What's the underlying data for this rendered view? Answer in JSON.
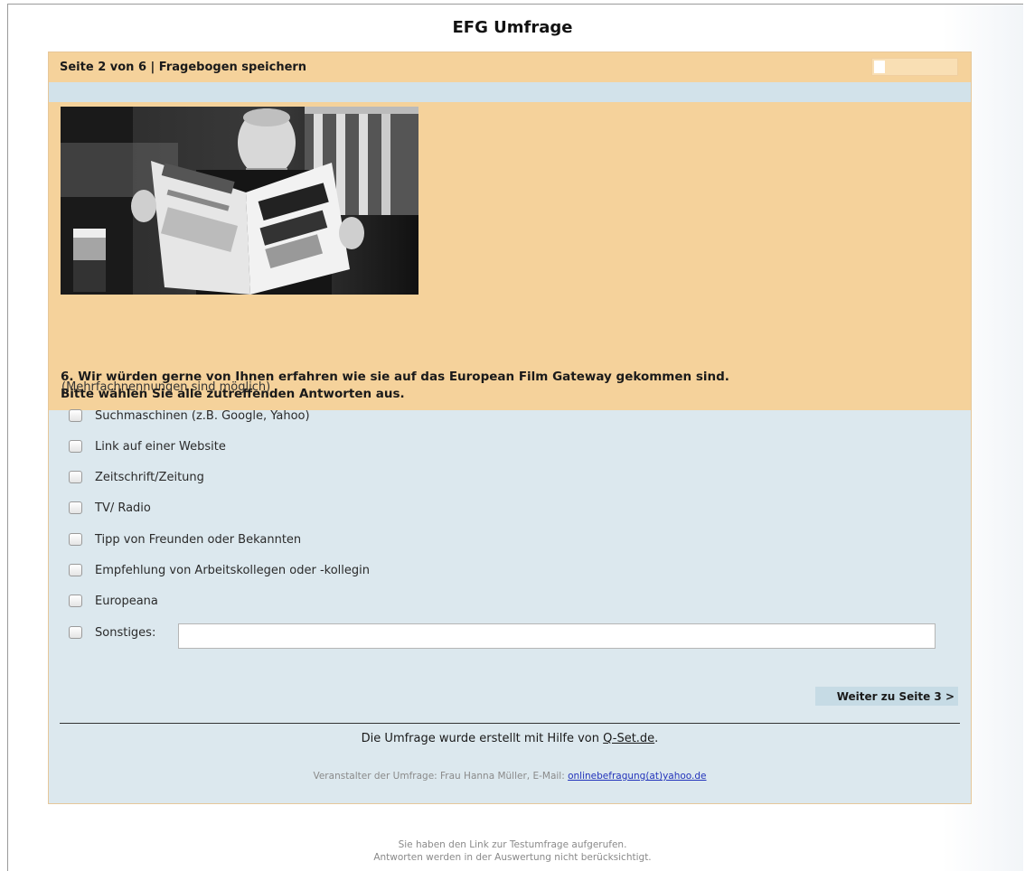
{
  "title": "EFG Umfrage",
  "pagebar": {
    "text": "Seite 2 von 6 | Fragebogen speichern"
  },
  "question": {
    "line1": "6. Wir würden gerne von Ihnen erfahren wie sie auf das European Film Gateway gekommen sind.",
    "line2": "Bitte wählen Sie alle zutreffenden Antworten aus."
  },
  "hint": "(Mehrfachnennungen sind möglich)",
  "options": [
    "Suchmaschinen (z.B. Google, Yahoo)",
    "Link auf einer Website",
    "Zeitschrift/Zeitung",
    "TV/ Radio",
    "Tipp von Freunden oder Bekannten",
    "Empfehlung von Arbeitskollegen oder -kollegin",
    "Europeana",
    "Sonstiges:"
  ],
  "other_input": {
    "value": ""
  },
  "next_button": "Weiter zu Seite 3 >",
  "credit": {
    "prefix": "Die Umfrage wurde erstellt mit Hilfe von",
    "link": "Q-Set.de",
    "suffix": "."
  },
  "organizer": {
    "prefix": "Veranstalter der Umfrage: Frau Hanna Müller, E-Mail:",
    "email": "onlinebefragung(at)yahoo.de"
  },
  "footnote": {
    "line1": "Sie haben den Link zur Testumfrage aufgerufen.",
    "line2": "Antworten werden in der Auswertung nicht berücksichtigt."
  },
  "colors": {
    "header_band": "#f5d29b",
    "panel": "#dce8ee",
    "link": "#2233bb"
  }
}
